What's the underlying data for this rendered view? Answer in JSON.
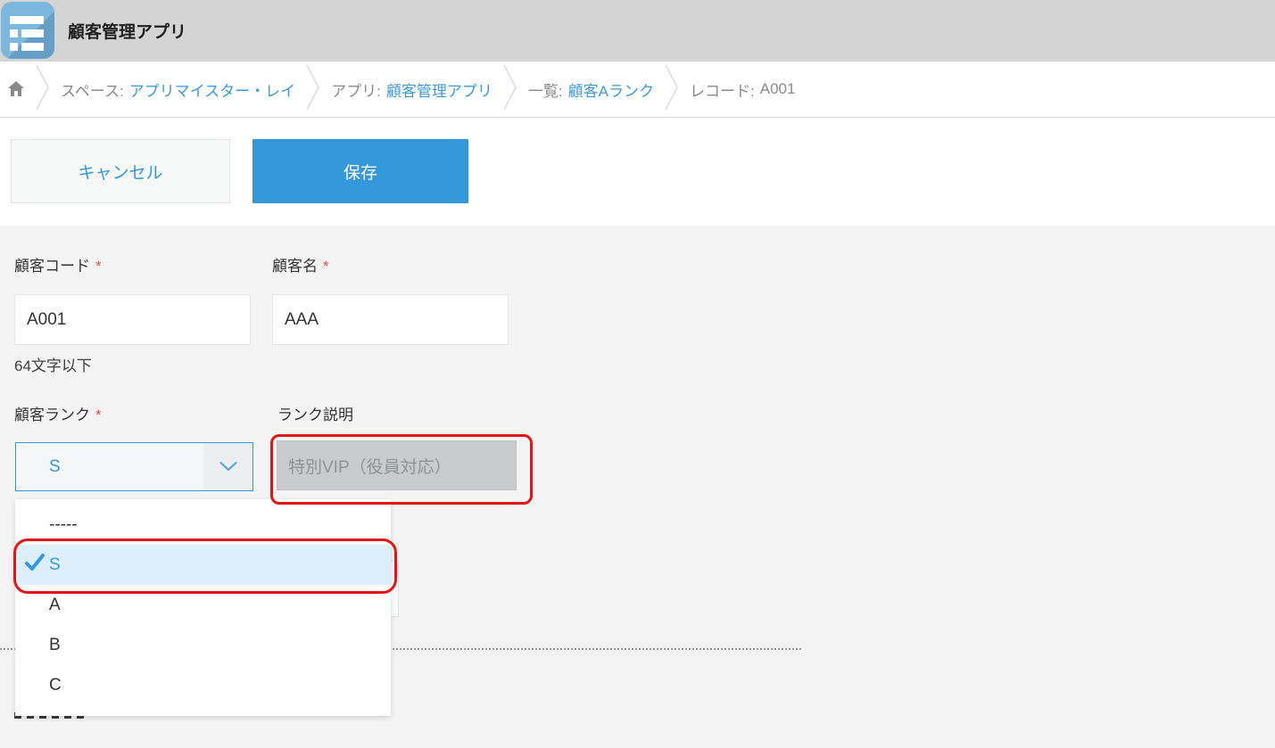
{
  "header": {
    "app_title": "顧客管理アプリ"
  },
  "breadcrumb": {
    "items": [
      {
        "prefix": "スペース:",
        "name": "アプリマイスター・レイ",
        "is_link": true
      },
      {
        "prefix": "アプリ:",
        "name": "顧客管理アプリ",
        "is_link": true
      },
      {
        "prefix": "一覧:",
        "name": "顧客Aランク",
        "is_link": true
      },
      {
        "prefix": "レコード:",
        "name": "A001",
        "is_link": false
      }
    ]
  },
  "toolbar": {
    "cancel_label": "キャンセル",
    "save_label": "保存"
  },
  "form": {
    "customer_code": {
      "label": "顧客コード",
      "required_mark": "*",
      "value": "A001",
      "hint": "64文字以下"
    },
    "customer_name": {
      "label": "顧客名",
      "required_mark": "*",
      "value": "AAA"
    },
    "customer_rank": {
      "label": "顧客ランク",
      "required_mark": "*",
      "selected_value": "S"
    },
    "rank_description": {
      "label": "ランク説明",
      "value": "特別VIP（役員対応）",
      "disabled": true
    }
  },
  "dropdown": {
    "options": [
      {
        "label": "-----",
        "selected": false
      },
      {
        "label": "S",
        "selected": true
      },
      {
        "label": "A",
        "selected": false
      },
      {
        "label": "B",
        "selected": false
      },
      {
        "label": "C",
        "selected": false
      }
    ]
  },
  "colors": {
    "accent_blue": "#3498db",
    "selected_option_bg": "#ddeefb",
    "annotation_red": "#e11717",
    "header_bar_bg": "#d4d4d4",
    "disabled_field_bg": "#c9cccd",
    "page_bg": "#f4f4f4",
    "required_red": "#e74c3c"
  },
  "icons": {
    "app_icon": "list",
    "home_icon": "house",
    "breadcrumb_separator_icon": "chevron-right",
    "select_arrow_icon": "chevron-down",
    "selected_option_icon": "check"
  }
}
